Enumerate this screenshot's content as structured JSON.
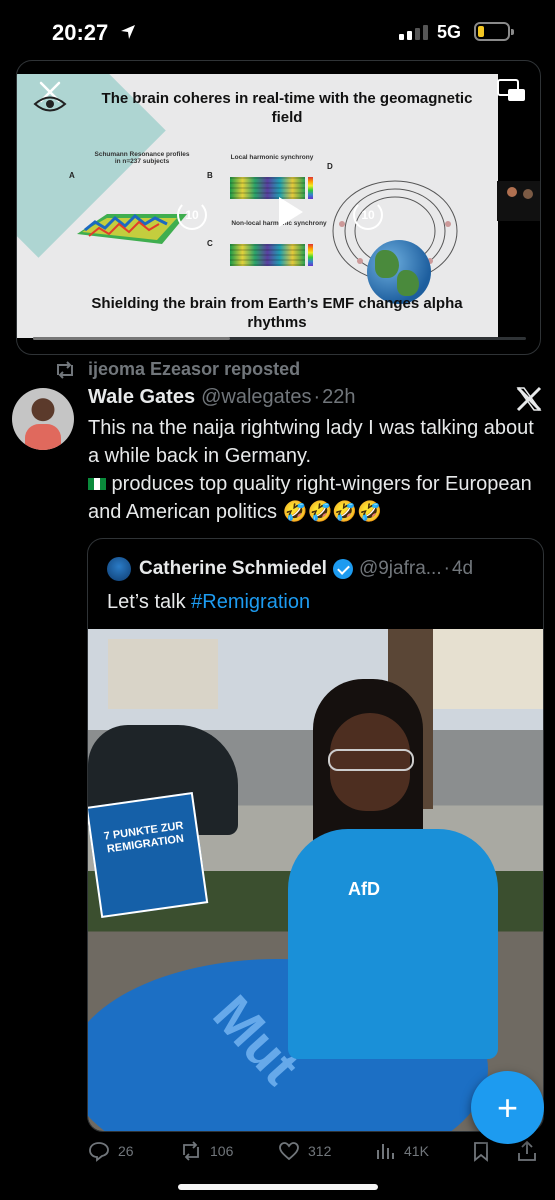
{
  "status_bar": {
    "time": "20:27",
    "network": "5G",
    "battery_level": 0.2
  },
  "video": {
    "slide_title": "The brain coheres in real-time with the geomagnetic field",
    "panel_a_label": "A",
    "panel_a_title": "Schumann Resonance profiles in n=237 subjects",
    "panel_b_label": "B",
    "panel_b_title": "Local harmonic synchrony",
    "panel_c_label": "C",
    "panel_c_title": "Non-local harmonic synchrony",
    "panel_d_label": "D",
    "slide_bottom": "Shielding the brain from Earth’s EMF changes alpha rhythms",
    "skip_back": "10",
    "skip_forward": "10",
    "progress": 0.4
  },
  "repost": {
    "text": "ijeoma Ezeasor reposted"
  },
  "tweet": {
    "name": "Wale Gates",
    "handle": "@walegates",
    "sep": "·",
    "time": "22h",
    "line1": "This na the naija rightwing lady I was talking about a while back in Germany.",
    "line2": " produces top quality right-wingers  for European and American politics 🤣🤣🤣🤣"
  },
  "quote": {
    "name": "Catherine Schmiedel",
    "handle": "@9jafra...",
    "sep": "·",
    "time": "4d",
    "text_prefix": "Let’s talk ",
    "hashtag": "#Remigration",
    "flyer_text": "7 PUNKTE ZUR REMIGRATION",
    "jacket_text": "AfD",
    "table_text": "Mut"
  },
  "actions": {
    "replies": "26",
    "reposts": "106",
    "likes": "312",
    "views": "41K"
  },
  "accent": "#1d9bf0"
}
